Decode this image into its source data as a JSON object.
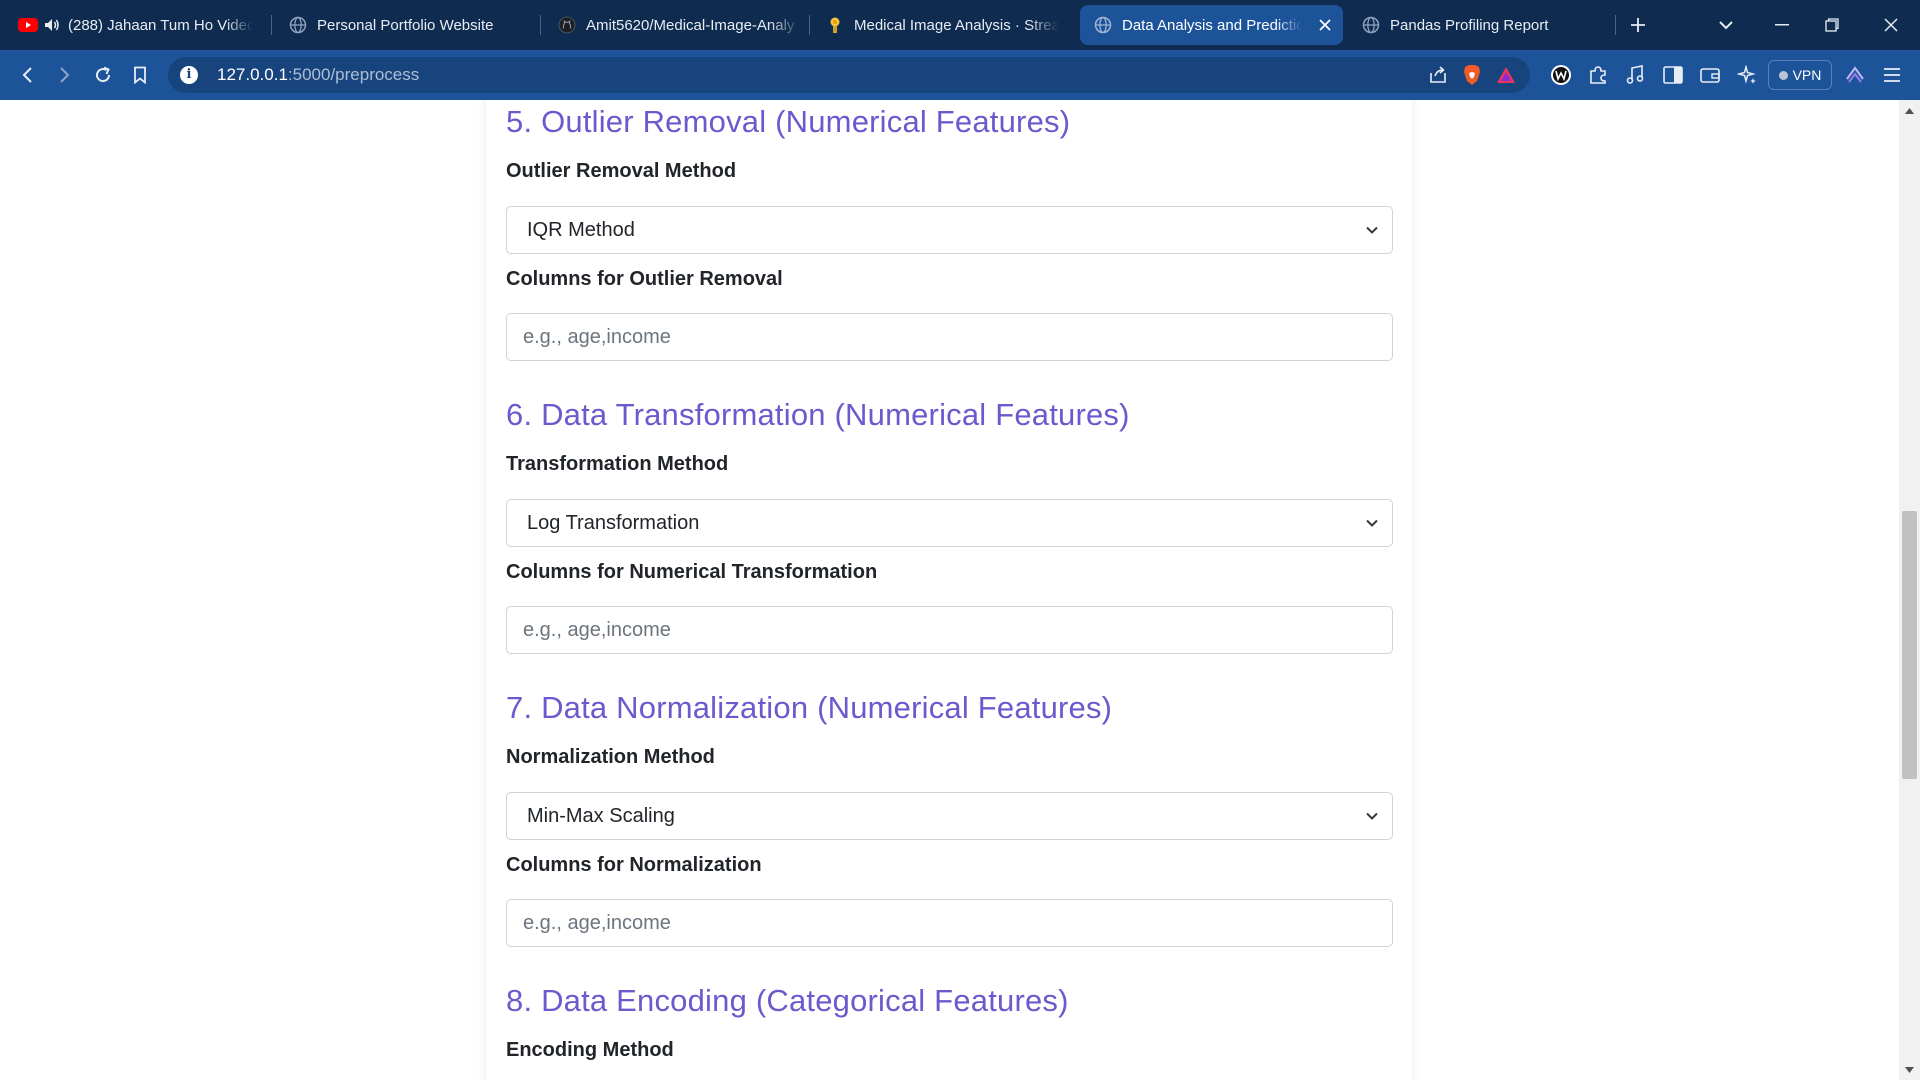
{
  "browser": {
    "tabs": [
      {
        "title": "(288) Jahaan Tum Ho Video",
        "favicon": "youtube-icon",
        "audio": true
      },
      {
        "title": "Personal Portfolio Website",
        "favicon": "globe-icon"
      },
      {
        "title": "Amit5620/Medical-Image-Analy",
        "favicon": "github-icon"
      },
      {
        "title": "Medical Image Analysis · Strean",
        "favicon": "streamlit-icon"
      },
      {
        "title": "Data Analysis and Predictio",
        "favicon": "globe-icon",
        "active": true
      },
      {
        "title": "Pandas Profiling Report",
        "favicon": "globe-icon"
      }
    ],
    "url_host": "127.0.0.1",
    "url_path": ":5000/preprocess",
    "vpn_label": "VPN"
  },
  "form": {
    "sections": [
      {
        "title": "5. Outlier Removal (Numerical Features)",
        "method_label": "Outlier Removal Method",
        "method_value": "IQR Method",
        "columns_label": "Columns for Outlier Removal",
        "columns_placeholder": "e.g., age,income"
      },
      {
        "title": "6. Data Transformation (Numerical Features)",
        "method_label": "Transformation Method",
        "method_value": "Log Transformation",
        "columns_label": "Columns for Numerical Transformation",
        "columns_placeholder": "e.g., age,income"
      },
      {
        "title": "7. Data Normalization (Numerical Features)",
        "method_label": "Normalization Method",
        "method_value": "Min-Max Scaling",
        "columns_label": "Columns for Normalization",
        "columns_placeholder": "e.g., age,income"
      },
      {
        "title": "8. Data Encoding (Categorical Features)",
        "method_label": "Encoding Method"
      }
    ]
  },
  "colors": {
    "tab_strip": "#0f2b4f",
    "toolbar": "#1d5499",
    "section_title": "#6a5acd",
    "label": "#212529"
  }
}
